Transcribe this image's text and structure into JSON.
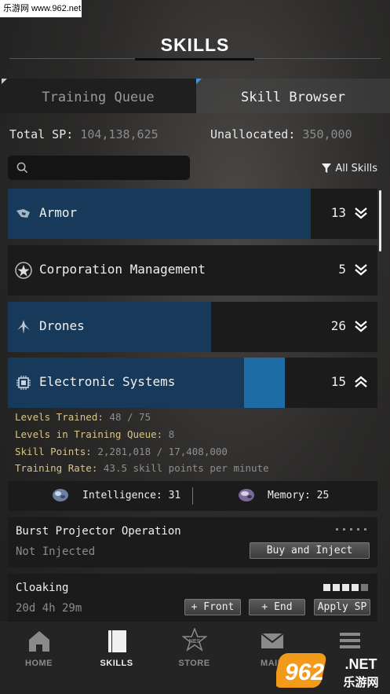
{
  "watermark": "乐游网 www.962.net",
  "header": {
    "title": "SKILLS"
  },
  "tabs": [
    {
      "label": "Training Queue",
      "active": false
    },
    {
      "label": "Skill Browser",
      "active": true
    }
  ],
  "stats": {
    "total_sp_label": "Total SP:",
    "total_sp_value": "104,138,625",
    "unallocated_label": "Unallocated:",
    "unallocated_value": "350,000"
  },
  "search": {
    "placeholder": "",
    "value": ""
  },
  "filter": {
    "label": "All Skills"
  },
  "colors": {
    "accent": "#1e6ca5",
    "fill": "#173a5a",
    "detail_label": "#d8c48a"
  },
  "categories": [
    {
      "name": "Armor",
      "count": "13",
      "icon": "armor-icon",
      "expanded": false,
      "progress": 0.82
    },
    {
      "name": "Corporation Management",
      "count": "5",
      "icon": "corporation-star-icon",
      "expanded": false,
      "progress": 0
    },
    {
      "name": "Drones",
      "count": "26",
      "icon": "drone-icon",
      "expanded": false,
      "progress": 0.55
    },
    {
      "name": "Electronic Systems",
      "count": "15",
      "icon": "chip-icon",
      "expanded": true,
      "progress": 0.64,
      "queued_progress": 0.11
    }
  ],
  "details": {
    "levels_trained_label": "Levels Trained:",
    "levels_trained_value": "48 / 75",
    "levels_queue_label": "Levels in Training Queue:",
    "levels_queue_value": "8",
    "skill_points_label": "Skill Points:",
    "skill_points_value": "2,281,018 / 17,408,000",
    "training_rate_label": "Training Rate:",
    "training_rate_value": "43.5 skill points per minute"
  },
  "attributes": {
    "primary_label": "Intelligence:",
    "primary_value": "31",
    "secondary_label": "Memory:",
    "secondary_value": "25"
  },
  "skills": [
    {
      "name": "Burst Projector Operation",
      "status": "Not Injected",
      "button": "Buy and Inject",
      "levels_trained": 0
    },
    {
      "name": "Cloaking",
      "status": "20d 4h 29m",
      "btn_front": "+ Front",
      "btn_end": "+ End",
      "btn_apply": "Apply SP",
      "levels_trained": 4
    }
  ],
  "nav": [
    {
      "label": "HOME",
      "icon": "home-icon",
      "active": false
    },
    {
      "label": "SKILLS",
      "icon": "skills-book-icon",
      "active": true
    },
    {
      "label": "STORE",
      "icon": "store-nes-icon",
      "active": false
    },
    {
      "label": "MAIL",
      "icon": "mail-icon",
      "active": false
    },
    {
      "label": "",
      "icon": "menu-icon",
      "active": false
    }
  ],
  "badge": {
    "text": "962.NET",
    "subtext": "乐游网"
  }
}
